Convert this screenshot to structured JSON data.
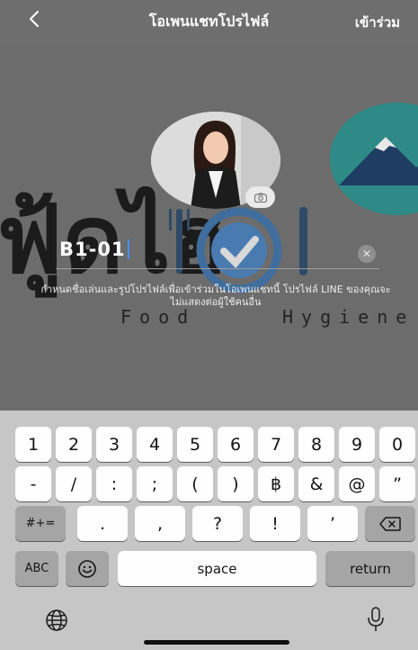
{
  "header": {
    "title": "โอเพนแชทโปรไฟล์",
    "join_label": "เข้าร่วม"
  },
  "profile": {
    "name_value": "B1-01",
    "hint_text": "กำหนดชื่อเล่นและรูปโปรไฟล์เพื่อเข้าร่วมในโอเพนแชทนี้ โปรไฟล์ LINE ของคุณจะไม่แสดงต่อผู้ใช้คนอื่น"
  },
  "watermark": {
    "thai_text": "ฟู้ดไฮ",
    "english_text": "Food Hygiene"
  },
  "keyboard": {
    "row1": [
      "1",
      "2",
      "3",
      "4",
      "5",
      "6",
      "7",
      "8",
      "9",
      "0"
    ],
    "row2": [
      "-",
      "/",
      ":",
      ";",
      "(",
      ")",
      "฿",
      "&",
      "@",
      "”"
    ],
    "row3_toggle": "#+=",
    "row3": [
      ".",
      ",",
      "?",
      "!",
      "’"
    ],
    "abc_label": "ABC",
    "space_label": "space",
    "return_label": "return"
  },
  "colors": {
    "overlay": "#6e6e6e",
    "keyboard_bg": "#c6c6c6",
    "key_bg": "#8c8c8c",
    "cursor": "#4a8cff",
    "avatar_teal": "#2d8a86"
  }
}
